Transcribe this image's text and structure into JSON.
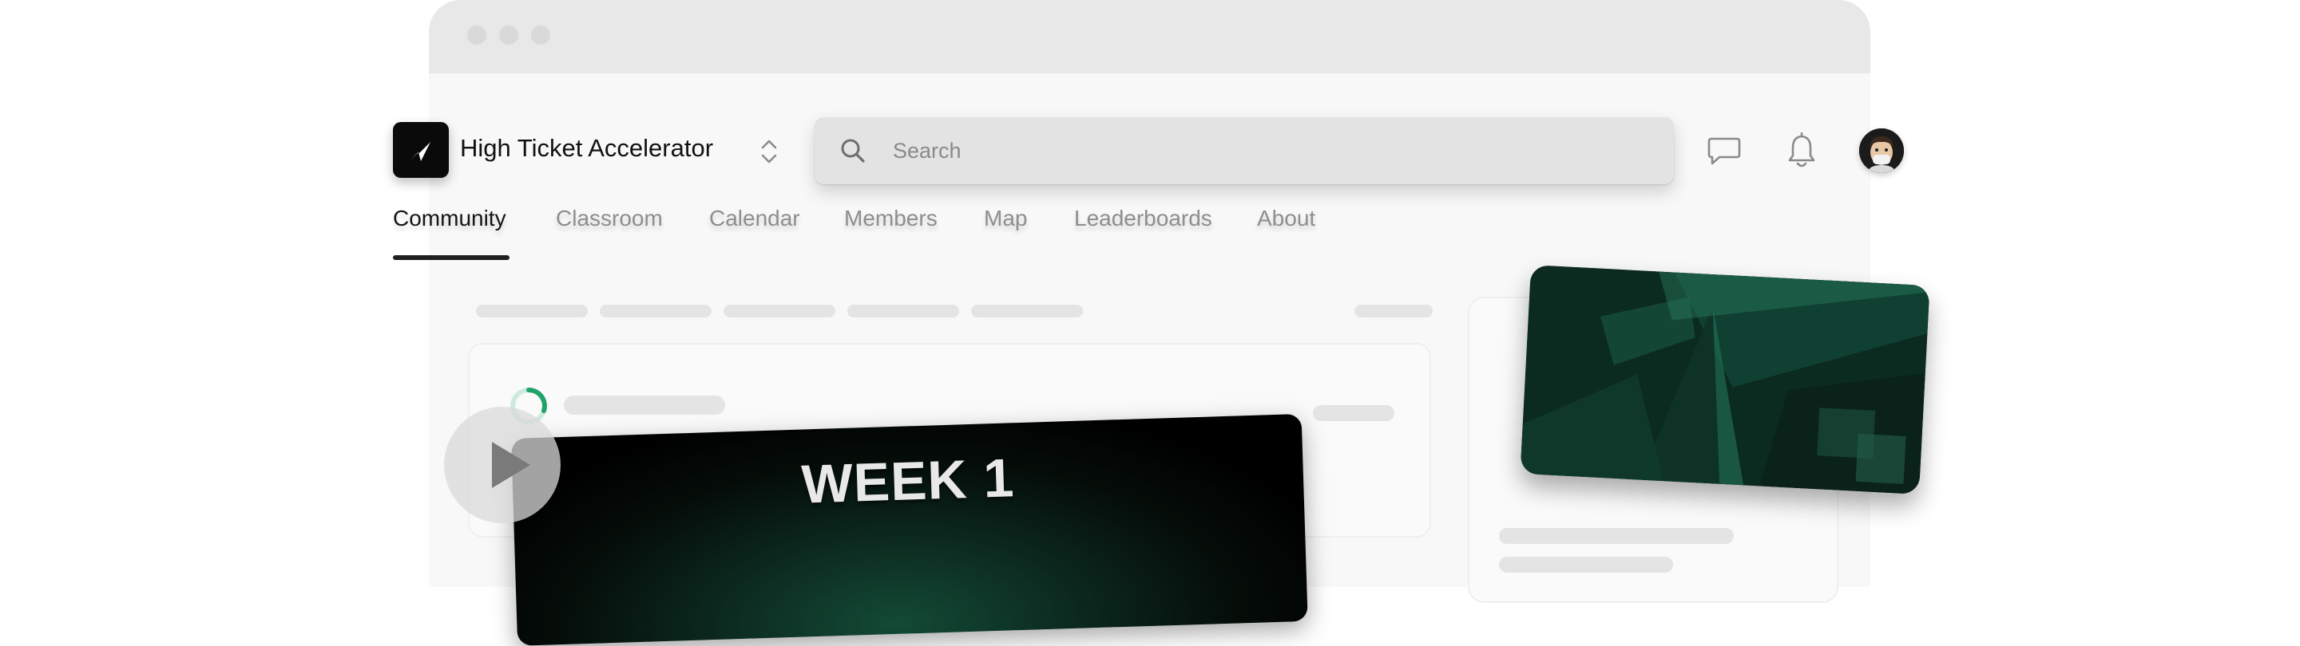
{
  "app": {
    "title": "High Ticket Accelerator",
    "logo_icon": "paper-plane-logo",
    "switch_icon": "chevron-up-down-icon"
  },
  "search": {
    "placeholder": "Search",
    "icon": "search-icon"
  },
  "header_icons": [
    "chat-icon",
    "bell-icon",
    "avatar"
  ],
  "tabs": [
    {
      "label": "Community",
      "active": true
    },
    {
      "label": "Classroom",
      "active": false
    },
    {
      "label": "Calendar",
      "active": false
    },
    {
      "label": "Members",
      "active": false
    },
    {
      "label": "Map",
      "active": false
    },
    {
      "label": "Leaderboards",
      "active": false
    },
    {
      "label": "About",
      "active": false
    }
  ],
  "video": {
    "title": "WEEK 1"
  },
  "colors": {
    "accent_green": "#1fa36b",
    "dark_green": "#0c2a1f",
    "text_primary": "#111111",
    "tab_inactive": "#8e8e8e"
  }
}
